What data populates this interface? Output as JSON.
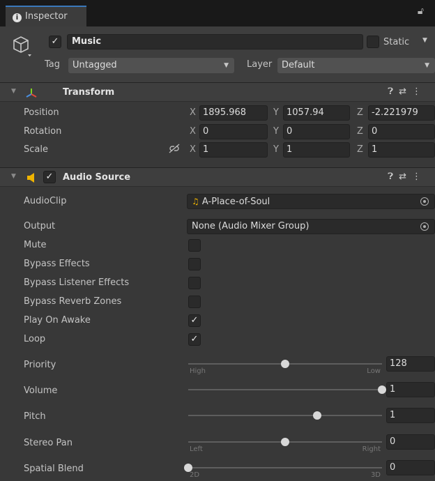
{
  "tab": {
    "label": "Inspector"
  },
  "object": {
    "name": "Music",
    "active": true,
    "static_label": "Static",
    "static": false,
    "tag_label": "Tag",
    "tag_value": "Untagged",
    "layer_label": "Layer",
    "layer_value": "Default"
  },
  "transform": {
    "title": "Transform",
    "rows": [
      {
        "label": "Position",
        "x": "1895.968",
        "y": "1057.94",
        "z": "-2.221979"
      },
      {
        "label": "Rotation",
        "x": "0",
        "y": "0",
        "z": "0"
      },
      {
        "label": "Scale",
        "x": "1",
        "y": "1",
        "z": "1"
      }
    ],
    "axes": {
      "x": "X",
      "y": "Y",
      "z": "Z"
    }
  },
  "audio": {
    "title": "Audio Source",
    "enabled": true,
    "clip_label": "AudioClip",
    "clip_value": "A-Place-of-Soul",
    "output_label": "Output",
    "output_value": "None (Audio Mixer Group)",
    "toggles": [
      {
        "label": "Mute",
        "checked": false
      },
      {
        "label": "Bypass Effects",
        "checked": false
      },
      {
        "label": "Bypass Listener Effects",
        "checked": false
      },
      {
        "label": "Bypass Reverb Zones",
        "checked": false
      },
      {
        "label": "Play On Awake",
        "checked": true
      },
      {
        "label": "Loop",
        "checked": true
      }
    ],
    "sliders": [
      {
        "label": "Priority",
        "value": "128",
        "fraction": 0.5,
        "min_label": "High",
        "max_label": "Low"
      },
      {
        "label": "Volume",
        "value": "1",
        "fraction": 1.0,
        "min_label": "",
        "max_label": ""
      },
      {
        "label": "Pitch",
        "value": "1",
        "fraction": 0.667,
        "min_label": "",
        "max_label": ""
      },
      {
        "label": "Stereo Pan",
        "value": "0",
        "fraction": 0.5,
        "min_label": "Left",
        "max_label": "Right"
      },
      {
        "label": "Spatial Blend",
        "value": "0",
        "fraction": 0.0,
        "min_label": "2D",
        "max_label": "3D"
      }
    ]
  },
  "colors": {
    "accent": "#3a79bb",
    "audio_icon": "#f0b400"
  }
}
